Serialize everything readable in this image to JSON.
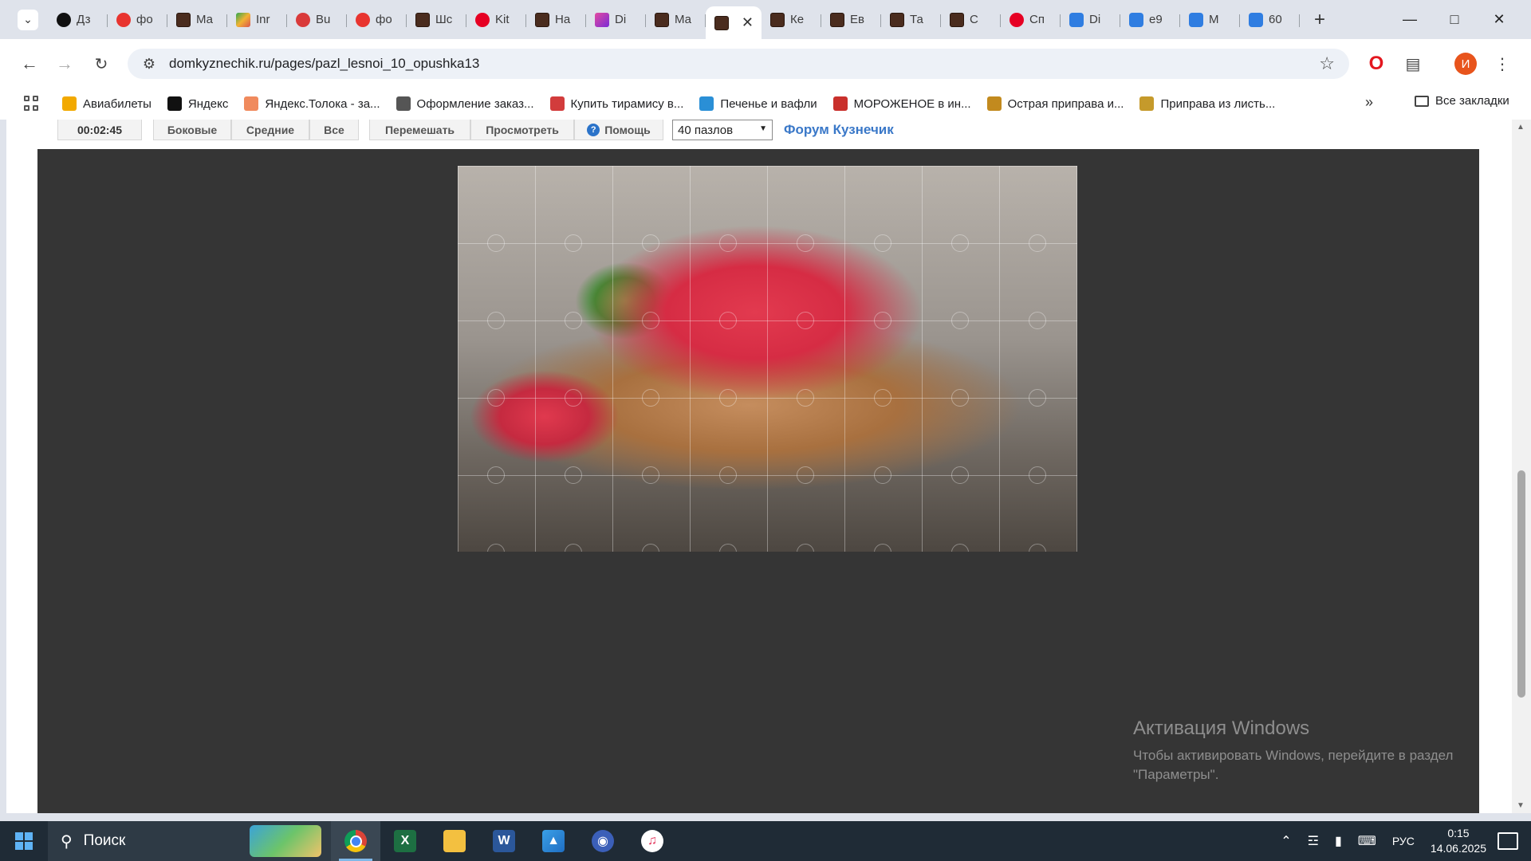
{
  "tabs": [
    {
      "label": "Дз",
      "icon": "yandex-plus-icon"
    },
    {
      "label": "фо",
      "icon": "yandex-icon"
    },
    {
      "label": "Ма",
      "icon": "site-icon"
    },
    {
      "label": "Inr",
      "icon": "multicolor-icon"
    },
    {
      "label": "Bu",
      "icon": "berry-icon"
    },
    {
      "label": "фо",
      "icon": "yandex-icon"
    },
    {
      "label": "Шс",
      "icon": "site-icon"
    },
    {
      "label": "Kit",
      "icon": "pinterest-icon"
    },
    {
      "label": "На",
      "icon": "site-icon"
    },
    {
      "label": "Di",
      "icon": "flower-icon"
    },
    {
      "label": "Ма",
      "icon": "site-icon"
    },
    {
      "label": "",
      "icon": "site-icon",
      "active": true
    },
    {
      "label": "Ке",
      "icon": "site-icon"
    },
    {
      "label": "Ев",
      "icon": "site-icon"
    },
    {
      "label": "Та",
      "icon": "site-icon"
    },
    {
      "label": "С",
      "icon": "site-icon"
    },
    {
      "label": "Сп",
      "icon": "pinterest-icon"
    },
    {
      "label": "Di",
      "icon": "blue-icon"
    },
    {
      "label": "e9",
      "icon": "blue-icon"
    },
    {
      "label": "M",
      "icon": "blue-icon"
    },
    {
      "label": "60",
      "icon": "blue-icon"
    }
  ],
  "address": {
    "url": "domkyznechik.ru/pages/pazl_lesnoi_10_opushka13"
  },
  "bookmarks": [
    {
      "label": "Авиабилеты",
      "icon": "plane-icon",
      "color": "#f2a900"
    },
    {
      "label": "Яндекс",
      "icon": "yandex-plus-icon",
      "color": "#111111"
    },
    {
      "label": "Яндекс.Толока - за...",
      "icon": "toloka-icon",
      "color": "#f08a5d"
    },
    {
      "label": "Оформление заказ...",
      "icon": "globe-icon",
      "color": "#555555"
    },
    {
      "label": "Купить тирамису в...",
      "icon": "cake-icon",
      "color": "#d23c3c"
    },
    {
      "label": "Печенье и вафли",
      "icon": "basket-icon",
      "color": "#2a8fd6"
    },
    {
      "label": "МОРОЖЕНОЕ в ин...",
      "icon": "letter-icon",
      "color": "#c9302c"
    },
    {
      "label": "Острая приправа и...",
      "icon": "spice-icon",
      "color": "#c28a1e"
    },
    {
      "label": "Приправа из листь...",
      "icon": "herb-icon",
      "color": "#c59a2b"
    }
  ],
  "bookmarks_all": "Все закладки",
  "puzzle_controls": {
    "timer": "00:02:45",
    "side": "Боковые",
    "middle": "Средние",
    "all": "Все",
    "shuffle": "Перемешать",
    "preview": "Просмотреть",
    "help": "Помощь",
    "pieces": "40 пазлов",
    "forum": "Форум Кузнечик"
  },
  "activation": {
    "title": "Активация Windows",
    "line1": "Чтобы активировать Windows, перейдите в раздел",
    "line2": "\"Параметры\"."
  },
  "taskbar": {
    "search": "Поиск",
    "lang": "РУС",
    "time": "0:15",
    "date": "14.06.2025"
  },
  "colors": {
    "stage": "#353535",
    "link": "#3a78c8",
    "taskbar": "#1f2b36"
  }
}
